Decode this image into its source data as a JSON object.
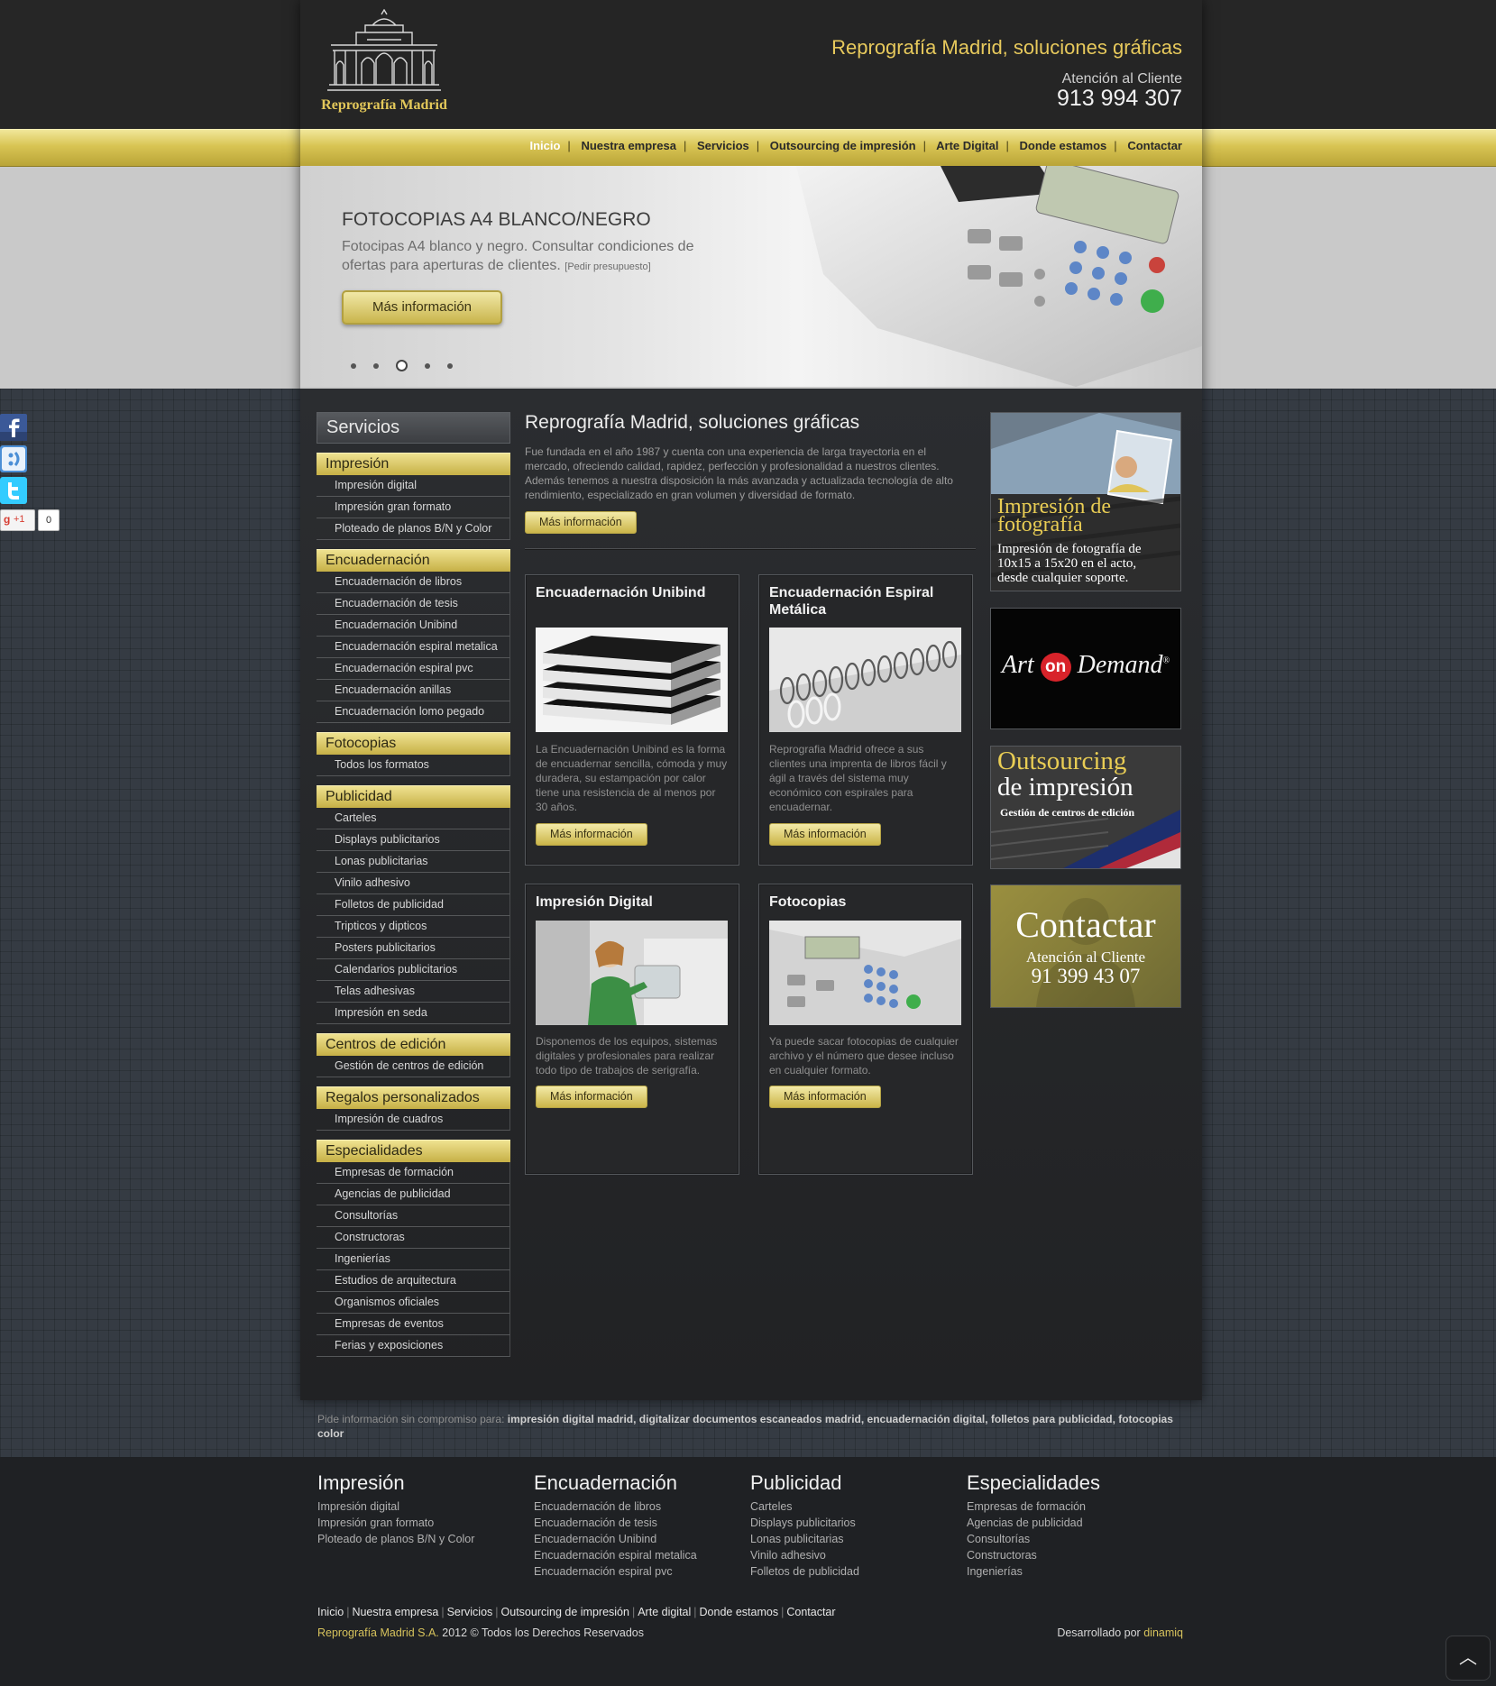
{
  "brand": {
    "logo_text": "Reprografía Madrid",
    "accent": "#e7c95c"
  },
  "header": {
    "tagline": "Reprografía Madrid, soluciones gráficas",
    "phone_label": "Atención al Cliente",
    "phone_number": "913 994 307"
  },
  "nav": {
    "items": [
      "Inicio",
      "Nuestra empresa",
      "Servicios",
      "Outsourcing de impresión",
      "Arte Digital",
      "Donde estamos",
      "Contactar"
    ],
    "active": "Inicio"
  },
  "slider": {
    "title": "FOTOCOPIAS A4 BLANCO/NEGRO",
    "desc": "Fotocipas A4 blanco y negro. Consultar condiciones de ofertas para aperturas de clientes.",
    "link": "[Pedir presupuesto]",
    "button": "Más información",
    "dots_total": 5,
    "active_dot": 3
  },
  "sidebar": {
    "title": "Servicios",
    "categories": [
      {
        "name": "Impresión",
        "items": [
          "Impresión digital",
          "Impresión gran formato",
          "Ploteado de planos B/N y Color"
        ]
      },
      {
        "name": "Encuadernación",
        "items": [
          "Encuadernación de libros",
          "Encuadernación de tesis",
          "Encuadernación Unibind",
          "Encuadernación espiral metalica",
          "Encuadernación espiral pvc",
          "Encuadernación anillas",
          "Encuadernación lomo pegado"
        ]
      },
      {
        "name": "Fotocopias",
        "items": [
          "Todos los formatos"
        ]
      },
      {
        "name": "Publicidad",
        "items": [
          "Carteles",
          "Displays publicitarios",
          "Lonas publicitarias",
          "Vinilo adhesivo",
          "Folletos de publicidad",
          "Tripticos y dipticos",
          "Posters publicitarios",
          "Calendarios publicitarios",
          "Telas adhesivas",
          "Impresión en seda"
        ]
      },
      {
        "name": "Centros de edición",
        "items": [
          "Gestión de centros de edición"
        ]
      },
      {
        "name": "Regalos personalizados",
        "items": [
          "Impresión de cuadros"
        ]
      },
      {
        "name": "Especialidades",
        "items": [
          "Empresas de formación",
          "Agencias de publicidad",
          "Consultorías",
          "Constructoras",
          "Ingenierías",
          "Estudios de arquitectura",
          "Organismos oficiales",
          "Empresas de eventos",
          "Ferias y exposiciones"
        ]
      }
    ]
  },
  "main": {
    "title": "Reprografía Madrid, soluciones gráficas",
    "desc": "Fue fundada en el año 1987 y cuenta con una experiencia de larga trayectoria en el mercado, ofreciendo calidad, rapidez, perfección y profesionalidad a nuestros clientes. Además tenemos a nuestra disposición la más avanzada y actualizada tecnología de alto rendimiento, especializado en gran volumen y diversidad de formato.",
    "button": "Más información",
    "cards": [
      {
        "title": "Encuadernación Unibind",
        "desc": "La Encuadernación Unibind es la forma de encuadernar sencilla, cómoda y muy duradera, su estampación por calor tiene una resistencia de al menos por 30 años.",
        "button": "Más información"
      },
      {
        "title": "Encuadernación Espiral Metálica",
        "desc": "Reprografia Madrid ofrece a sus clientes una imprenta de libros fácil y ágil a través del sistema muy económico con espirales para encuadernar.",
        "button": "Más información"
      },
      {
        "title": "Impresión Digital",
        "desc": "Disponemos de los equipos, sistemas digitales y profesionales para realizar todo tipo de trabajos de serigrafía.",
        "button": "Más información"
      },
      {
        "title": "Fotocopias",
        "desc": "Ya puede sacar fotocopias de cualquier archivo y el número que desee incluso en cualquier formato.",
        "button": "Más información"
      }
    ]
  },
  "promos": {
    "photo": {
      "title_line1": "Impresión de",
      "title_line2": "fotografía",
      "text_line1": "Impresión de fotografía de",
      "text_line2": "10x15 a 15x20 en el acto,",
      "text_line3": "desde cualquier soporte."
    },
    "art": {
      "word1": "Art",
      "word2": "on",
      "word3": "Demand",
      "mark": "®"
    },
    "outsourcing": {
      "line1": "Outsourcing",
      "line2": "de impresión",
      "line3": "Gestión de centros de edición"
    },
    "contact": {
      "title": "Contactar",
      "label": "Atención al Cliente",
      "phone": "91 399 43 07"
    }
  },
  "seo": {
    "prefix": "Pide información sin compromiso para:",
    "keywords": "impresión digital madrid, digitalizar documentos escaneados madrid, encuadernación digital, folletos para publicidad, fotocopias color"
  },
  "footer": {
    "columns": [
      {
        "title": "Impresión",
        "links": [
          "Impresión digital",
          "Impresión gran formato",
          "Ploteado de planos B/N y Color"
        ]
      },
      {
        "title": "Encuadernación",
        "links": [
          "Encuadernación de libros",
          "Encuadernación de tesis",
          "Encuadernación Unibind",
          "Encuadernación espiral metalica",
          "Encuadernación espiral pvc"
        ]
      },
      {
        "title": "Publicidad",
        "links": [
          "Carteles",
          "Displays publicitarios",
          "Lonas publicitarias",
          "Vinilo adhesivo",
          "Folletos de publicidad"
        ]
      },
      {
        "title": "Especialidades",
        "links": [
          "Empresas de formación",
          "Agencias de publicidad",
          "Consultorías",
          "Constructoras",
          "Ingenierías"
        ]
      }
    ],
    "nav": [
      "Inicio",
      "Nuestra empresa",
      "Servicios",
      "Outsourcing de impresión",
      "Arte digital",
      "Donde estamos",
      "Contactar"
    ],
    "copy_brand": "Reprografía Madrid S.A.",
    "copy_rest": "2012 © Todos los Derechos Reservados",
    "dev_label": "Desarrollado por",
    "dev_link": "dinamiq"
  },
  "social": {
    "gplus_label": "+1",
    "gplus_count": "0"
  },
  "scroll_top_glyph": "︿"
}
